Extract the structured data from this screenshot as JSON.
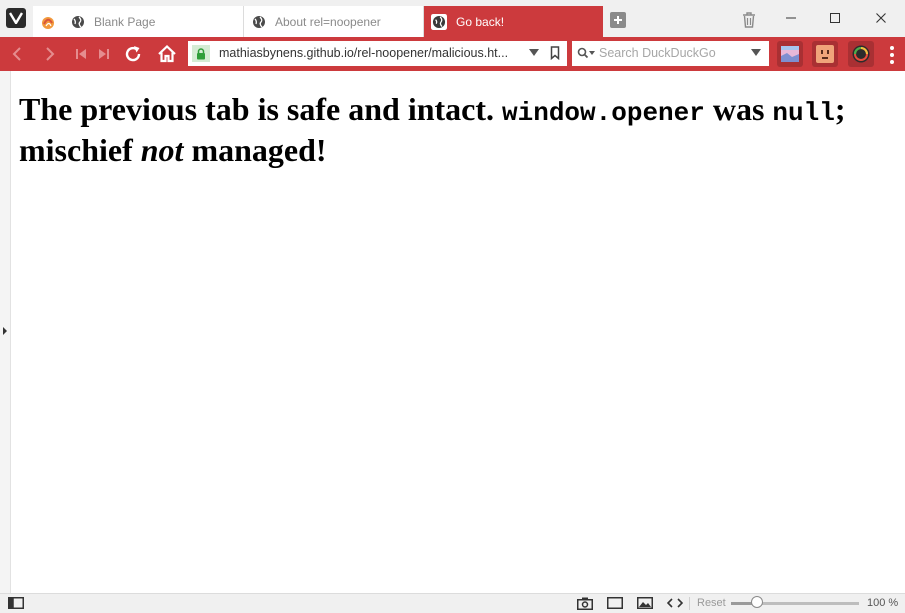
{
  "tabs": [
    {
      "title": "Blank Page",
      "active": false
    },
    {
      "title": "About rel=noopener",
      "active": false
    },
    {
      "title": "Go back!",
      "active": true
    }
  ],
  "address": {
    "url": "mathiasbynens.github.io/rel-noopener/malicious.ht..."
  },
  "search": {
    "placeholder": "Search DuckDuckGo"
  },
  "content": {
    "part1": "The previous tab is safe and intact. ",
    "code1": "window.opener",
    "part2": " was ",
    "code2": "null",
    "part3": "; mischief ",
    "emph": "not",
    "part4": " managed!"
  },
  "status": {
    "reset_label": "Reset",
    "zoom_label": "100 %",
    "zoom_value": 0.2
  },
  "colors": {
    "accent": "#cc3a3d",
    "tab_text": "#8a8a8a"
  },
  "icons": {
    "brand": "vivaldi-logo-icon",
    "tab": "globe-icon",
    "secure": "lock-icon",
    "search": "magnifier-icon"
  }
}
